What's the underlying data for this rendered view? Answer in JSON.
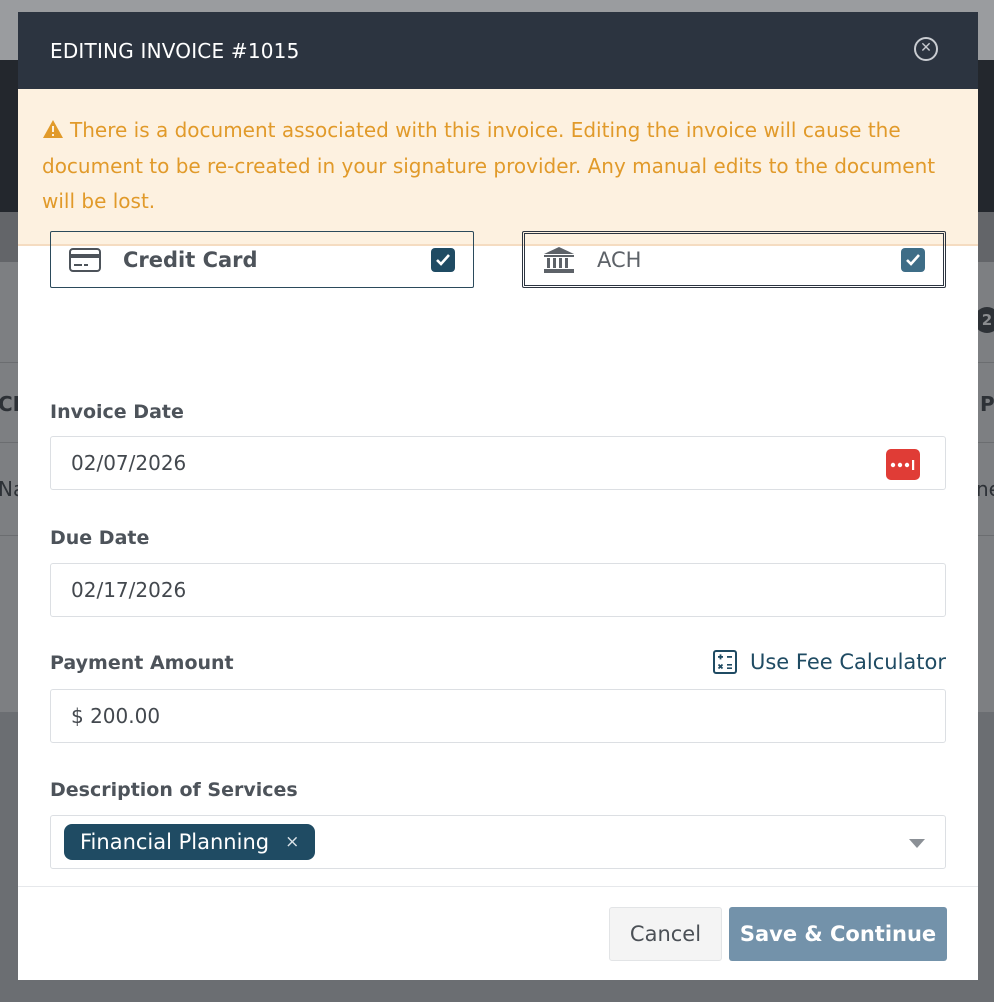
{
  "background": {
    "col_left_header": "CL",
    "col_right_header": "P",
    "row_left_text": "Na",
    "row_right_text": "ne",
    "badge": "2"
  },
  "modal": {
    "title": "EDITING INVOICE #1015",
    "close_icon": "circle-x-icon"
  },
  "alert": {
    "icon": "warning-triangle-icon",
    "text": "There is a document associated with this invoice. Editing the invoice will cause the document to be re-created in your signature provider. Any manual edits to the document will be lost.",
    "color": "#e19a2a"
  },
  "payment_methods": [
    {
      "label": "Credit Card",
      "icon": "credit-card-icon",
      "checked": true
    },
    {
      "label": "ACH",
      "icon": "bank-icon",
      "checked": true
    }
  ],
  "invoice_date": {
    "label": "Invoice Date",
    "value": "02/07/2026",
    "picker_icon": "calendar-dots-icon"
  },
  "due_date": {
    "label": "Due Date",
    "value": "02/17/2026"
  },
  "payment_amount": {
    "label": "Payment Amount",
    "value": "$ 200.00",
    "fee_link": "Use Fee Calculator",
    "fee_icon": "calculator-icon"
  },
  "description": {
    "label": "Description of Services",
    "tags": [
      "Financial Planning"
    ],
    "remove_glyph": "×"
  },
  "footer": {
    "cancel": "Cancel",
    "save": "Save & Continue"
  },
  "colors": {
    "header": "#2c3440",
    "primary": "#1f4b63",
    "danger": "#e03c36",
    "save_button": "#7392aa"
  }
}
